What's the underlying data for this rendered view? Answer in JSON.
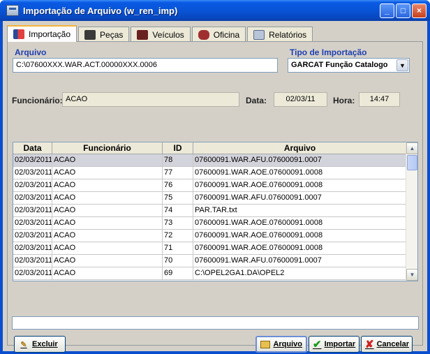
{
  "window": {
    "title": "Importação de Arquivo (w_ren_imp)",
    "minimize": "_",
    "maximize": "□",
    "close": "×"
  },
  "tabs": [
    {
      "label": "Importação",
      "icon": "import-icon"
    },
    {
      "label": "Peças",
      "icon": "parts-icon"
    },
    {
      "label": "Veículos",
      "icon": "vehicle-icon"
    },
    {
      "label": "Oficina",
      "icon": "workshop-icon"
    },
    {
      "label": "Relatórios",
      "icon": "report-icon"
    }
  ],
  "form": {
    "arquivo_label": "Arquivo",
    "arquivo_value": "C:\\07600XXX.WAR.ACT.00000XXX.0006",
    "tipo_label": "Tipo de Importação",
    "tipo_value": "GARCAT Função Catalogo",
    "funcionario_label": "Funcionário:",
    "funcionario_value": "ACAO",
    "data_label": "Data:",
    "data_value": "02/03/11",
    "hora_label": "Hora:",
    "hora_value": "14:47"
  },
  "grid": {
    "columns": [
      "Data",
      "Funcionário",
      "ID",
      "Arquivo"
    ],
    "rows": [
      [
        "02/03/2011",
        "ACAO",
        "78",
        "07600091.WAR.AFU.07600091.0007"
      ],
      [
        "02/03/2011",
        "ACAO",
        "77",
        "07600091.WAR.AOE.07600091.0008"
      ],
      [
        "02/03/2011",
        "ACAO",
        "76",
        "07600091.WAR.AOE.07600091.0008"
      ],
      [
        "02/03/2011",
        "ACAO",
        "75",
        "07600091.WAR.AFU.07600091.0007"
      ],
      [
        "02/03/2011",
        "ACAO",
        "74",
        "PAR.TAR.txt"
      ],
      [
        "02/03/2011",
        "ACAO",
        "73",
        "07600091.WAR.AOE.07600091.0008"
      ],
      [
        "02/03/2011",
        "ACAO",
        "72",
        "07600091.WAR.AOE.07600091.0008"
      ],
      [
        "02/03/2011",
        "ACAO",
        "71",
        "07600091.WAR.AOE.07600091.0008"
      ],
      [
        "02/03/2011",
        "ACAO",
        "70",
        "07600091.WAR.AFU.07600091.0007"
      ],
      [
        "02/03/2011",
        "ACAO",
        "69",
        "C:\\OPEL2GA1.DA\\OPEL2"
      ]
    ]
  },
  "buttons": {
    "excluir": "Excluir",
    "arquivo": "Arquivo",
    "importar": "Importar",
    "cancelar": "Cancelar"
  }
}
